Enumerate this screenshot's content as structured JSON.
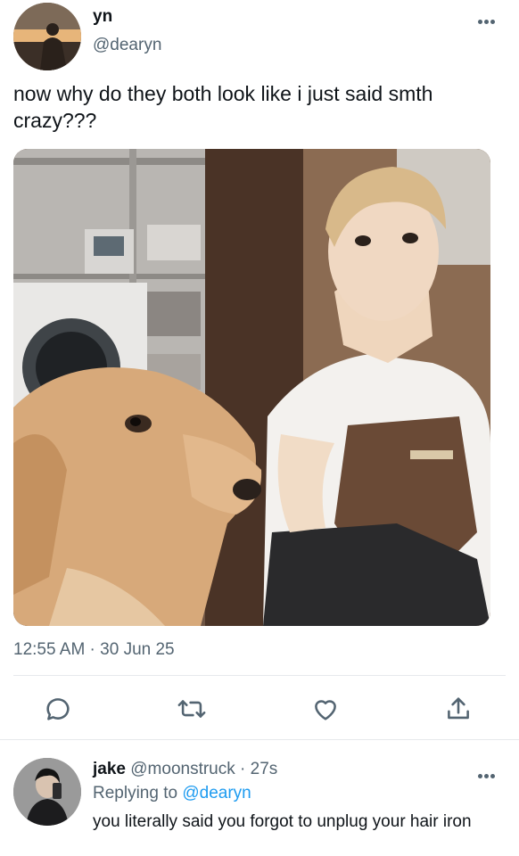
{
  "tweet": {
    "author_name": "yn",
    "author_handle": "@dearyn",
    "text": "now why do they both look like i just said smth crazy???",
    "timestamp": "12:55 AM · 30 Jun 25",
    "icons": {
      "more": "more-horizontal-icon",
      "reply": "reply-bubble-icon",
      "retweet": "retweet-icon",
      "like": "heart-icon",
      "share": "share-upload-icon"
    }
  },
  "reply": {
    "author_name": "jake",
    "author_handle": "@moonstruck",
    "separator": "·",
    "time": "27s",
    "replying_prefix": "Replying to",
    "replying_handle": "@dearyn",
    "text": "you literally said you forgot to unplug your hair iron"
  },
  "colors": {
    "text_primary": "#0f1419",
    "text_secondary": "#536471",
    "link": "#1d9bf0",
    "divider": "#e6e9ec"
  }
}
